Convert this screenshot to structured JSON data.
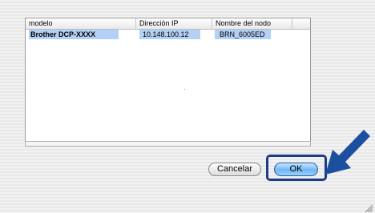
{
  "table": {
    "headers": [
      "modelo",
      "Dirección IP",
      "Nombre del nodo"
    ],
    "rows": [
      {
        "model": "Brother DCP-XXXX",
        "ip": "10.148.100.12",
        "node": "BRN_6005ED"
      }
    ]
  },
  "buttons": {
    "cancel_label": "Cancelar",
    "ok_label": "OK"
  },
  "colors": {
    "arrow": "#1c4fa0",
    "focus_ring": "#1c3c8a",
    "selection": "#b4d0f6"
  },
  "icons": [
    "pointer-arrow-icon",
    "resize-grip-icon"
  ]
}
